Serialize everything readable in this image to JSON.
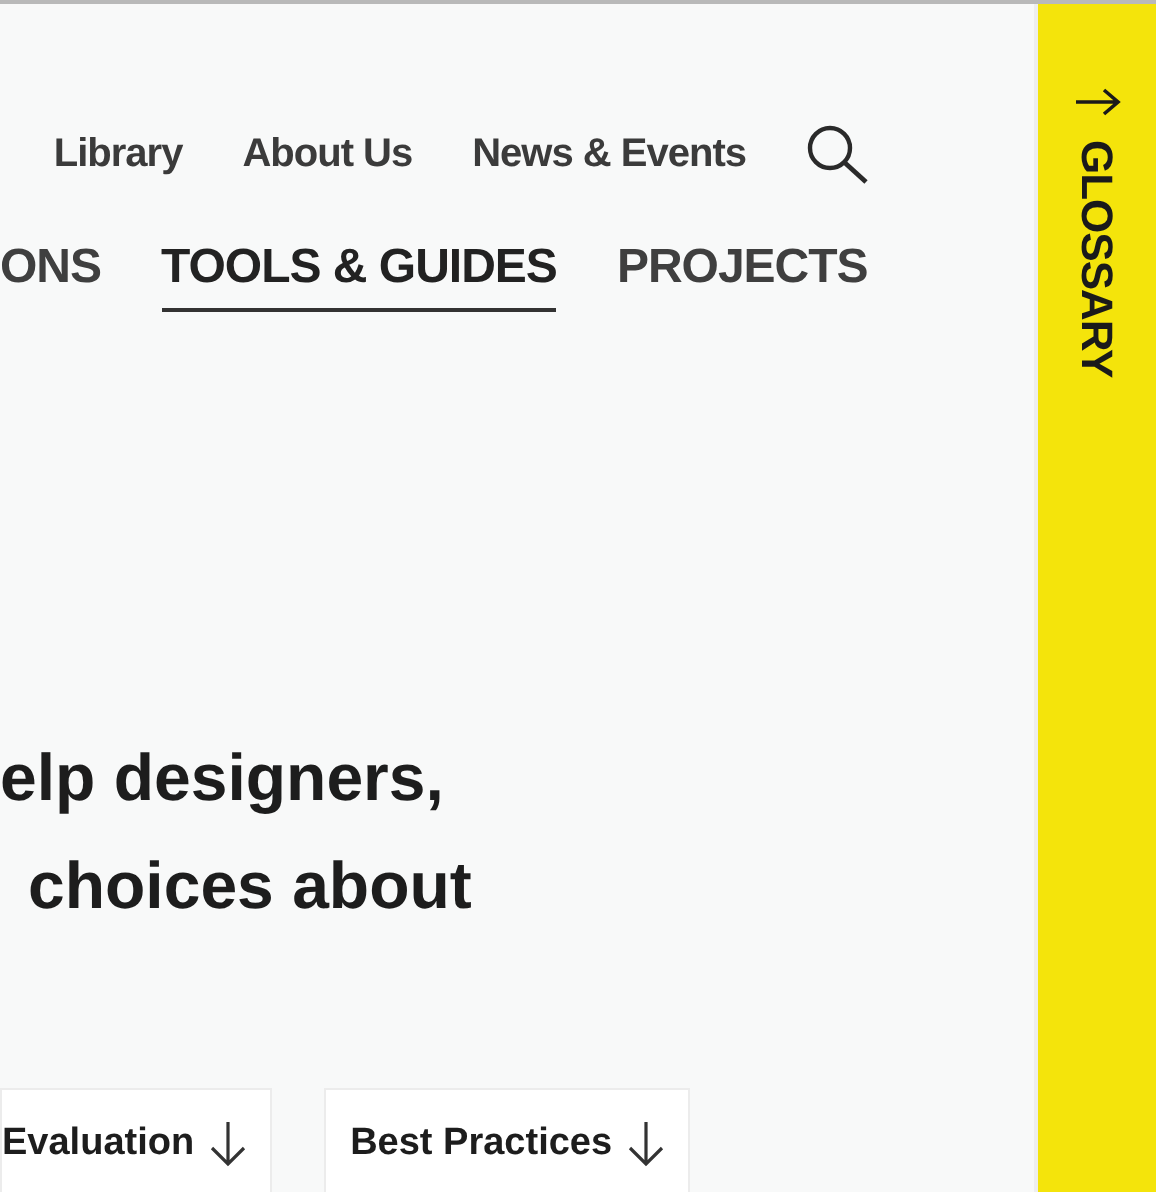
{
  "utility_nav": [
    {
      "label": "Library"
    },
    {
      "label": "About Us"
    },
    {
      "label": "News & Events"
    }
  ],
  "main_nav": [
    {
      "label": "ONS",
      "selected": false
    },
    {
      "label": "TOOLS & GUIDES",
      "selected": true
    },
    {
      "label": "PROJECTS",
      "selected": false
    }
  ],
  "headline": [
    "elp designers,",
    "choices about"
  ],
  "section_links": [
    {
      "label": "Evaluation"
    },
    {
      "label": "Best Practices"
    }
  ],
  "glossary_tab": {
    "label": "GLOSSARY"
  }
}
